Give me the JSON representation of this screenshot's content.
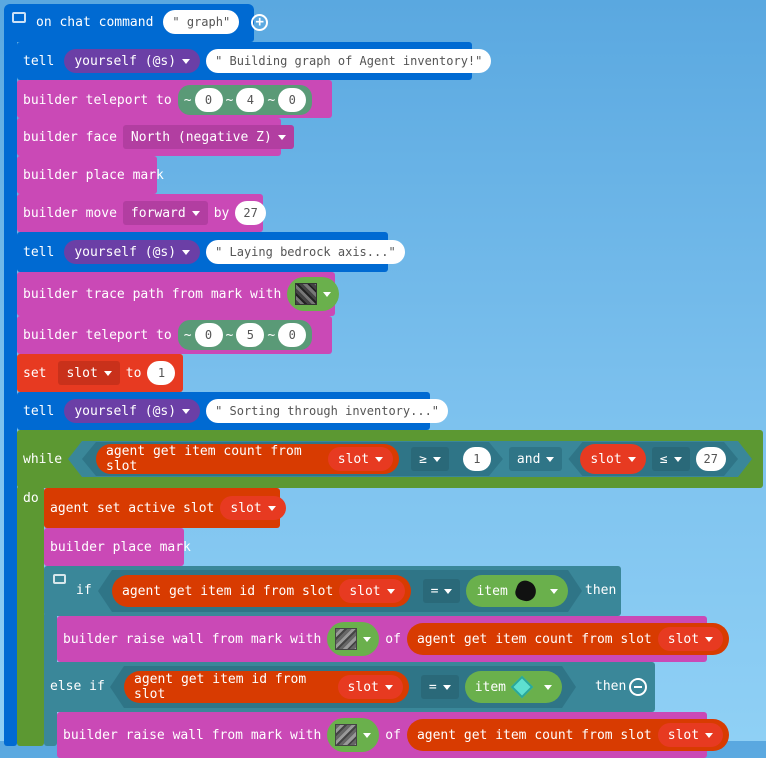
{
  "event": {
    "label": "on chat command",
    "command": "\" graph\""
  },
  "colors": {
    "player": "#006ad2",
    "builder": "#ca49b6",
    "variables": "#e73a21",
    "agent": "#d83b01",
    "loops": "#5c9832",
    "logic": "#3a8799",
    "mobs": "#6b3fa6",
    "positions": "#5a9a77",
    "blocks": "#6ab04c"
  },
  "lines": [
    {
      "keyword": "tell",
      "target": "yourself (@s)",
      "message": "\" Building graph of Agent inventory!\""
    },
    {
      "label": "builder teleport to",
      "pos": [
        "~",
        "0",
        "~",
        "4",
        "~",
        "0"
      ]
    },
    {
      "label": "builder face",
      "direction": "North (negative Z)"
    },
    {
      "label": "builder place mark"
    },
    {
      "label": "builder move",
      "direction": "forward",
      "by": "by",
      "amount": "27"
    },
    {
      "keyword": "tell",
      "target": "yourself (@s)",
      "message": "\" Laying bedrock axis...\""
    },
    {
      "label": "builder trace path from mark with",
      "block": "bedrock-icon"
    },
    {
      "label": "builder teleport to",
      "pos": [
        "~",
        "0",
        "~",
        "5",
        "~",
        "0"
      ]
    },
    {
      "keyword": "set",
      "var": "slot",
      "to": "to",
      "value": "1"
    },
    {
      "keyword": "tell",
      "target": "yourself (@s)",
      "message": "\" Sorting through inventory...\""
    }
  ],
  "while_block": {
    "keyword": "while",
    "do": "do",
    "cond1": "agent get item count from slot",
    "var": "slot",
    "op1": "≥",
    "val1": "1",
    "and": "and",
    "op2": "≤",
    "val2": "27"
  },
  "inner": {
    "set_active": "agent set active slot",
    "var": "slot",
    "place_mark": "builder place mark",
    "if": "if",
    "get_id": "agent get item id from slot",
    "eq": "=",
    "item": "item",
    "then": "then",
    "raise": "builder raise wall from mark with",
    "of": "of",
    "count": "agent get item count from slot",
    "else_if": "else if"
  }
}
